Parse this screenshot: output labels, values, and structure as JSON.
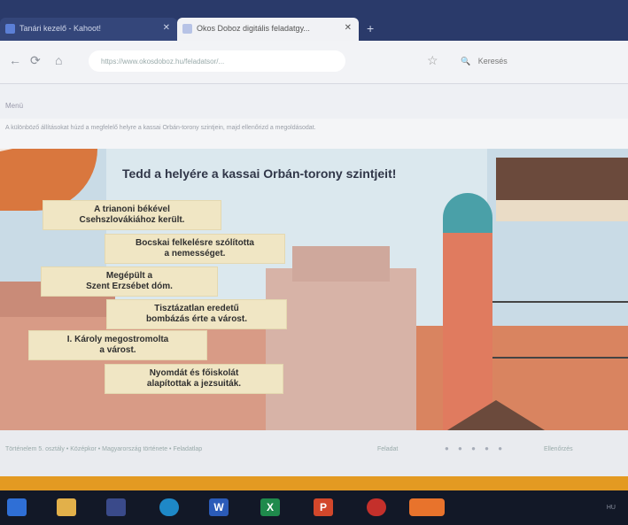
{
  "browser": {
    "tabs": [
      {
        "label": "Tanári kezelő - Kahoot!"
      },
      {
        "label": "Okos Doboz digitális feladatgy..."
      }
    ],
    "new_tab": "+",
    "url": "https://www.okosdoboz.hu/feladatsor/...",
    "search_placeholder": "Keresés",
    "back": "←",
    "reload": "⟳",
    "home": "⌂",
    "star": "☆"
  },
  "toolbar": {
    "label": "Menü"
  },
  "instruction": "A különböző állításokat húzd a megfelelő helyre a kassai Orbán-torony szintjein, majd ellenőrizd a megoldásodat.",
  "exercise": {
    "title": "Tedd a helyére a kassai Orbán-torony szintjeit!",
    "cards": [
      "A trianoni békével\nCsehszlovákiához került.",
      "Bocskai felkelésre szólította\na nemességet.",
      "Megépült a\nSzent Erzsébet dóm.",
      "Tisztázatlan eredetű\nbombázás érte a várost.",
      "I. Károly megostromolta\na várost.",
      "Nyomdát és főiskolát\nalapítottak a jezsuiták."
    ]
  },
  "footer": {
    "left": "Történelem 5. osztály • Középkor • Magyarország története • Feladatlap",
    "middle": "Feladat",
    "dots": "● ● ● ● ●",
    "right": "Ellenőrzés"
  },
  "colors": {
    "accent_orange": "#e39a22",
    "title_text": "#303648",
    "card_bg": "#f0e6c4",
    "logo_orange": "#d9773e"
  },
  "taskbar": {
    "apps": [
      {
        "icon": "file-explorer-icon"
      },
      {
        "icon": "media-player-icon"
      },
      {
        "icon": "edge-browser-icon"
      },
      {
        "icon": "word-icon",
        "letter": "W"
      },
      {
        "icon": "excel-icon",
        "letter": "X"
      },
      {
        "icon": "powerpoint-icon",
        "letter": "P"
      },
      {
        "icon": "paint-icon"
      },
      {
        "icon": "firefox-icon"
      }
    ],
    "tray": "HU"
  }
}
